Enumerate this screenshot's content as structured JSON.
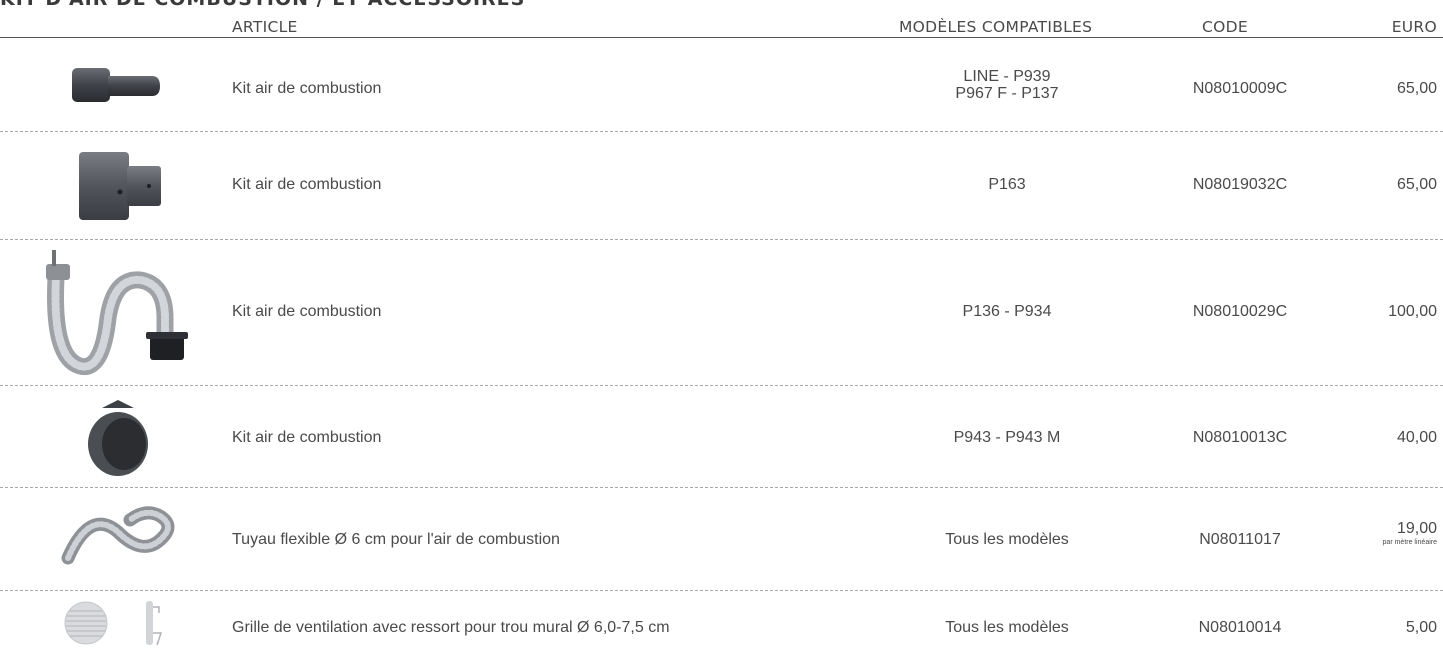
{
  "section_title": "KIT D'AIR DE COMBUSTION / ET ACCESSOIRES",
  "header": {
    "article": "ARTICLE",
    "models": "MODÈLES COMPATIBLES",
    "code": "CODE",
    "euro": "EURO"
  },
  "rows": [
    {
      "article": "Kit air de combustion",
      "models_line1": "LINE - P939",
      "models_line2": "P967 F - P137",
      "code": "N08010009C",
      "price": "65,00"
    },
    {
      "article": "Kit air de combustion",
      "models_line1": "P163",
      "code": "N08019032C",
      "price": "65,00"
    },
    {
      "article": "Kit air de combustion",
      "models_line1": "P136 - P934",
      "code": "N08010029C",
      "price": "100,00"
    },
    {
      "article": "Kit air de combustion",
      "models_line1": "P943 - P943 M",
      "code": "N08010013C",
      "price": "40,00"
    },
    {
      "article": "Tuyau flexible Ø 6 cm pour l'air de combustion",
      "models_line1": "Tous les modèles",
      "code": "N08011017",
      "price": "19,00",
      "price_note": "par mètre linéaire"
    },
    {
      "article": "Grille de ventilation avec ressort pour trou mural Ø 6,0-7,5 cm",
      "models_line1": "Tous les modèles",
      "code": "N08010014",
      "price": "5,00"
    }
  ]
}
